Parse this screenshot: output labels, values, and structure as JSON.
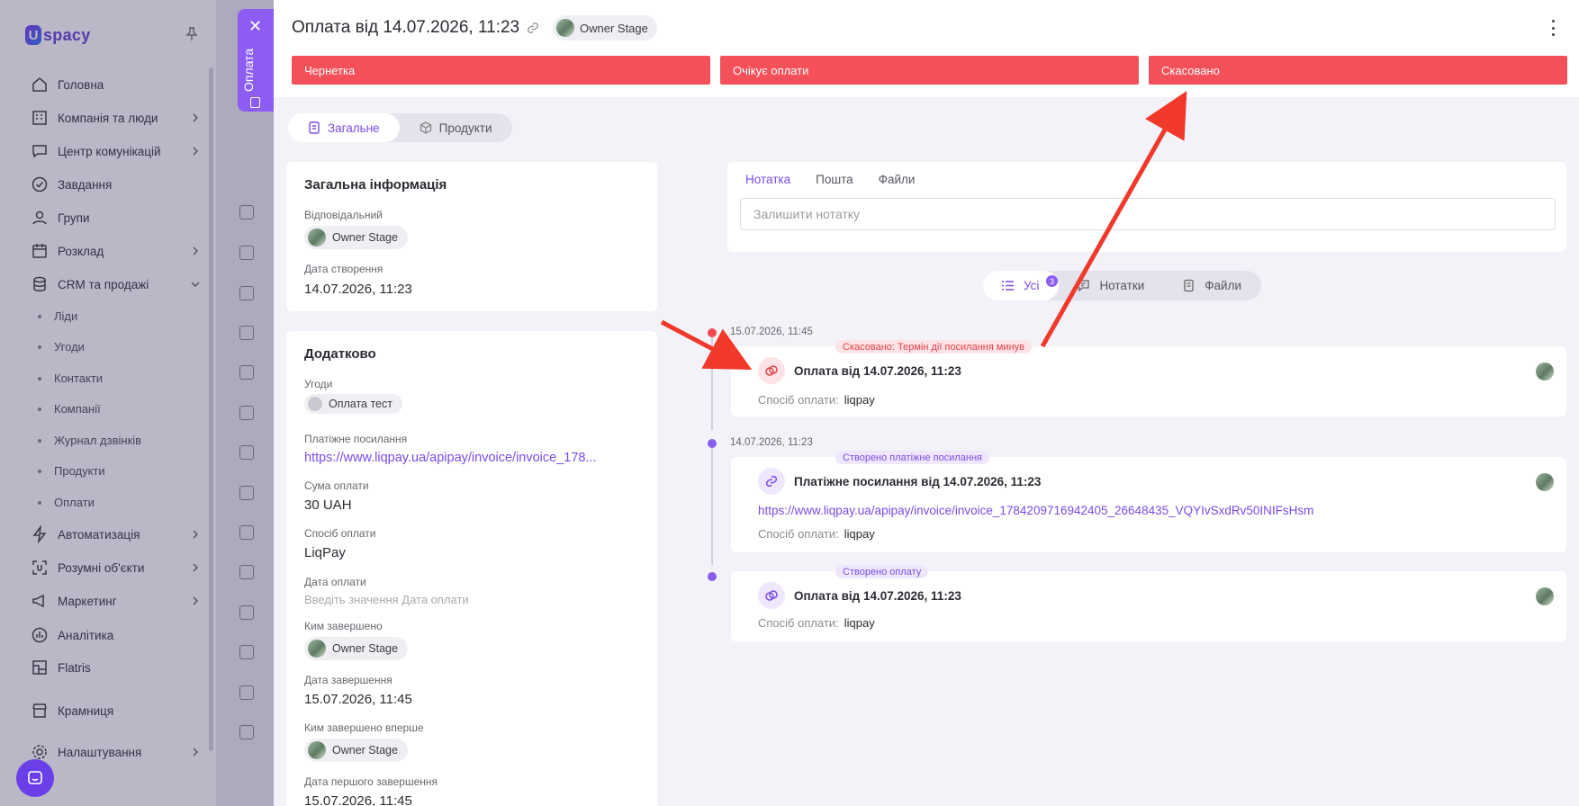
{
  "sidebar": {
    "logo": "spacy",
    "logo_mark": "U",
    "items": [
      {
        "label": "Головна",
        "icon": "home-icon"
      },
      {
        "label": "Компанія та люди",
        "icon": "building-icon"
      },
      {
        "label": "Центр комунікацій",
        "icon": "chat-icon"
      },
      {
        "label": "Завдання",
        "icon": "task-icon"
      },
      {
        "label": "Групи",
        "icon": "group-icon"
      },
      {
        "label": "Розклад",
        "icon": "calendar-icon"
      },
      {
        "label": "CRM та продажі",
        "icon": "database-icon"
      },
      {
        "label": "Автоматизація",
        "icon": "lightning-icon"
      },
      {
        "label": "Розумні об'єкти",
        "icon": "smart-object-icon"
      },
      {
        "label": "Маркетинг",
        "icon": "megaphone-icon"
      },
      {
        "label": "Аналітика",
        "icon": "analytics-icon"
      },
      {
        "label": "Flatris",
        "icon": "flatris-icon"
      },
      {
        "label": "Крамниця",
        "icon": "store-icon"
      },
      {
        "label": "Налаштування",
        "icon": "settings-icon"
      }
    ],
    "crm_sub": [
      "Ліди",
      "Угоди",
      "Контакти",
      "Компанії",
      "Журнал дзвінків",
      "Продукти",
      "Оплати"
    ]
  },
  "side_tab": {
    "label": "Оплата"
  },
  "header": {
    "title": "Оплата від 14.07.2026, 11:23",
    "owner": "Owner Stage",
    "stages": [
      "Чернетка",
      "Очікує оплати",
      "Скасовано"
    ],
    "stage_color": "#f4505a"
  },
  "tabs": {
    "general": "Загальне",
    "products": "Продукти"
  },
  "general_info": {
    "title": "Загальна інформація",
    "responsible_label": "Відповідальний",
    "responsible": "Owner Stage",
    "created_label": "Дата створення",
    "created": "14.07.2026, 11:23"
  },
  "additional": {
    "title": "Додатково",
    "deals_label": "Угоди",
    "deal": "Оплата тест",
    "link_label": "Платіжне посилання",
    "link": "https://www.liqpay.ua/apipay/invoice/invoice_178...",
    "sum_label": "Сума оплати",
    "sum": "30 UAH",
    "method_label": "Спосіб оплати",
    "method": "LiqPay",
    "paid_date_label": "Дата оплати",
    "paid_date_placeholder": "Введіть значення Дата оплати",
    "completed_by_label": "Ким завершено",
    "completed_by": "Owner Stage",
    "completed_date_label": "Дата завершення",
    "completed_date": "15.07.2026, 11:45",
    "first_completed_by_label": "Ким завершено вперше",
    "first_completed_by": "Owner Stage",
    "first_completed_date_label": "Дата першого завершення",
    "first_completed_date": "15.07.2026, 11:45"
  },
  "notes": {
    "tabs": [
      "Нотатка",
      "Пошта",
      "Файли"
    ],
    "placeholder": "Залишити нотатку"
  },
  "filters": {
    "all": "Усі",
    "all_count": "3",
    "notes": "Нотатки",
    "files": "Файли"
  },
  "timeline": [
    {
      "date": "15.07.2026, 11:45",
      "tag": "Скасовано: Термін дії посилання минув",
      "title": "Оплата від 14.07.2026, 11:23",
      "method_label": "Спосіб оплати:",
      "method": "liqpay"
    },
    {
      "date": "14.07.2026, 11:23",
      "tag": "Створено платіжне посилання",
      "title": "Платіжне посилання від 14.07.2026, 11:23",
      "link": "https://www.liqpay.ua/apipay/invoice/invoice_1784209716942405_26648435_VQYIvSxdRv50INIFsHsm",
      "method_label": "Спосіб оплати:",
      "method": "liqpay"
    },
    {
      "tag": "Створено оплату",
      "title": "Оплата від 14.07.2026, 11:23",
      "method_label": "Спосіб оплати:",
      "method": "liqpay"
    }
  ],
  "colors": {
    "accent": "#7b4ae6",
    "danger": "#f4505a",
    "arrow": "#f0392b"
  }
}
